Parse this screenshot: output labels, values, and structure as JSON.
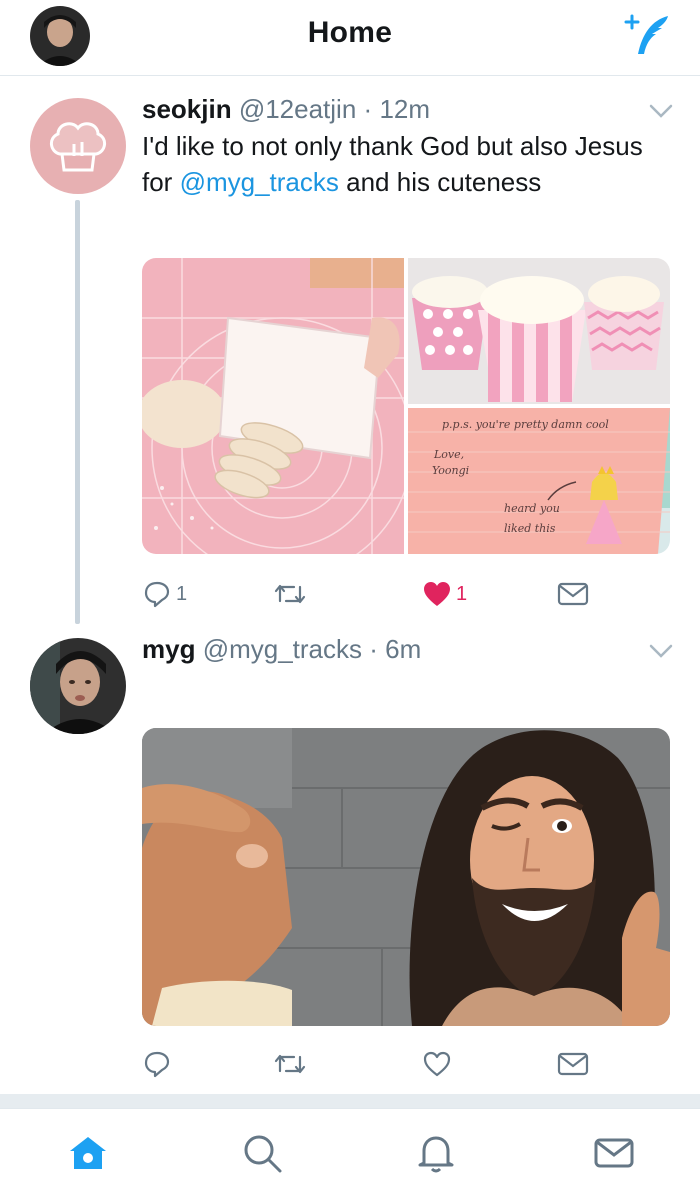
{
  "header": {
    "title": "Home",
    "profile_icon": "user-avatar",
    "compose_icon": "compose-tweet-icon",
    "accent_color": "#1da1f2"
  },
  "tweets": [
    {
      "name": "seokjin",
      "handle": "@12eatjin",
      "separator": "·",
      "time": "12m",
      "text_before": "I'd like to not only thank God but also Jesus for ",
      "mention": "@myg_tracks",
      "text_after": " and his cuteness",
      "avatar_icon": "chef-hat-icon",
      "media": [
        {
          "description_icon": "dough-scraper-photo"
        },
        {
          "description_icon": "cupcakes-photo"
        },
        {
          "description_icon": "note-card-photo",
          "note_lines": [
            "p.p.s. you're pretty damn cool",
            "Love,",
            "Yoongi",
            "heard you",
            "liked this"
          ]
        }
      ],
      "actions": {
        "reply_count": "1",
        "retweet_count": "",
        "like_count": "1",
        "liked": true
      }
    },
    {
      "name": "myg",
      "handle": "@myg_tracks",
      "separator": "·",
      "time": "6m",
      "avatar_icon": "user-avatar",
      "media": [
        {
          "description_icon": "buddy-christ-photo"
        }
      ],
      "actions": {
        "reply_count": "",
        "retweet_count": "",
        "like_count": "",
        "liked": false
      }
    }
  ],
  "tabbar": {
    "tabs": [
      "home-icon",
      "search-icon",
      "notifications-icon",
      "messages-icon"
    ],
    "active": "home-icon"
  },
  "colors": {
    "like": "#e0245e",
    "link": "#1b95e0",
    "secondary_text": "#657786"
  }
}
